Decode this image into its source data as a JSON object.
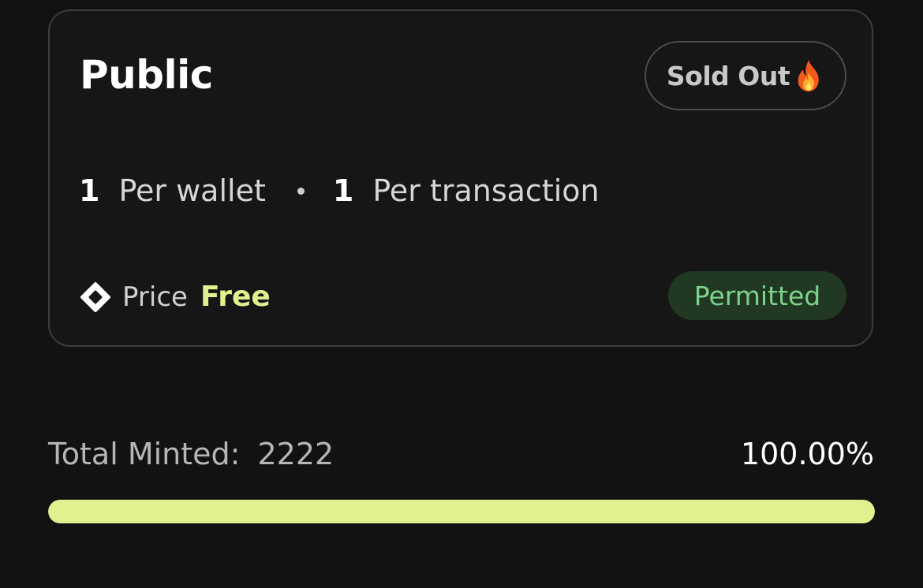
{
  "phase": {
    "title": "Public",
    "status_label": "Sold Out",
    "status_icon": "fire-icon",
    "per_wallet_count": "1",
    "per_wallet_label": "Per wallet",
    "per_tx_count": "1",
    "per_tx_label": "Per transaction",
    "price_icon": "diamond-icon",
    "price_label": "Price",
    "price_value": "Free",
    "permission_label": "Permitted"
  },
  "mint": {
    "total_label": "Total Minted:",
    "total_value": "2222",
    "percent_label": "100.00%",
    "progress_fraction": 1.0
  },
  "colors": {
    "accent": "#dff28f",
    "permitted_text": "#7dd38b",
    "permitted_bg": "#213823",
    "background": "#121212"
  }
}
